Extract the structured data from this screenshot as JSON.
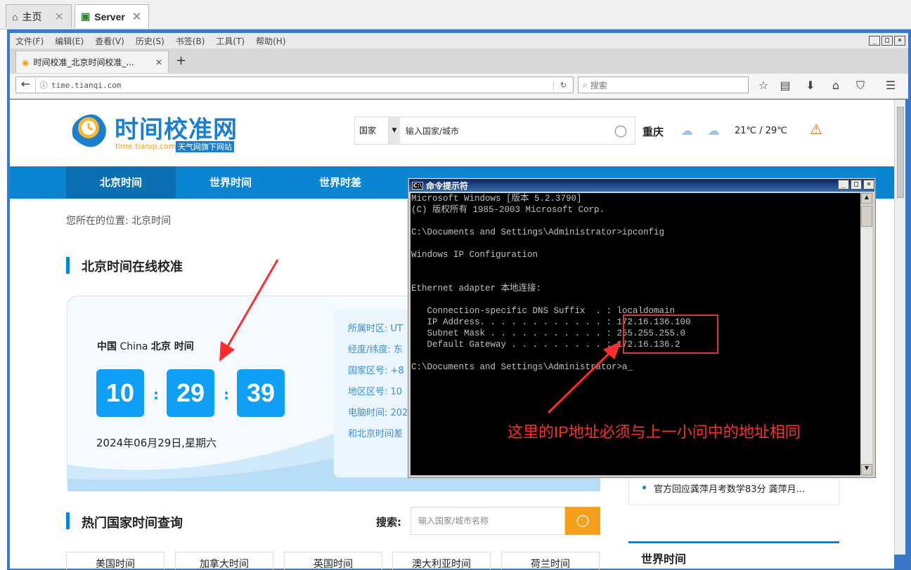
{
  "host": {
    "tabs": [
      {
        "label": "主页"
      },
      {
        "label": "Server"
      }
    ]
  },
  "firefox": {
    "menu": [
      "文件(F)",
      "编辑(E)",
      "查看(V)",
      "历史(S)",
      "书签(B)",
      "工具(T)",
      "帮助(H)"
    ],
    "tab_title": "时间校准_北京时间校准_...",
    "url": "time.tianqi.com",
    "search_placeholder": "搜索"
  },
  "site": {
    "logo_title": "时间校准网",
    "logo_domain": "time.tianqi.com",
    "logo_badge": "天气网旗下网站",
    "country_select": "国家",
    "city_placeholder": "输入国家/城市",
    "city": "重庆",
    "temperature": "21℃ / 29℃",
    "nav": [
      "北京时间",
      "世界时间",
      "世界时差"
    ],
    "breadcrumb": "您所在的位置: 北京时间",
    "section_title": "北京时间在线校准",
    "clock_label_cn": "中国",
    "clock_label_en": "China",
    "clock_label_city": "北京 时间",
    "hour": "10",
    "minute": "29",
    "second": "39",
    "date": "2024年06月29日,星期六",
    "info": [
      "所属时区: UT",
      "经度/纬度: 东",
      "国家区号: +8",
      "地区区号: 10",
      "电脑时间: 202",
      "和北京时间差"
    ],
    "news_item": "官方回应龚萍月考数学83分 龚萍月...",
    "hot_title": "热门国家时间查询",
    "search_label": "搜索:",
    "search_placeholder": "输入国家/城市名称",
    "world_time": "世界时间",
    "country_tabs": [
      "美国时间",
      "加拿大时间",
      "英国时间",
      "澳大利亚时间",
      "荷兰时间"
    ]
  },
  "cmd": {
    "title": "命令提示符",
    "lines": [
      "Microsoft Windows [版本 5.2.3790]",
      "(C) 版权所有 1985-2003 Microsoft Corp.",
      "",
      "C:\\Documents and Settings\\Administrator>ipconfig",
      "",
      "Windows IP Configuration",
      "",
      "",
      "Ethernet adapter 本地连接:",
      "",
      "   Connection-specific DNS Suffix  . : localdomain",
      "   IP Address. . . . . . . . . . . . : 172.16.136.100",
      "   Subnet Mask . . . . . . . . . . . : 255.255.255.0",
      "   Default Gateway . . . . . . . . . : 172.16.136.2",
      "",
      "C:\\Documents and Settings\\Administrator>a_"
    ]
  },
  "annotation": "这里的IP地址必须与上一小问中的地址相同",
  "colors": {
    "accent": "#0b84d2",
    "digit_bg": "#0fa0f5",
    "annotation": "#ff2d2d",
    "search_btn": "#f5a01a"
  }
}
